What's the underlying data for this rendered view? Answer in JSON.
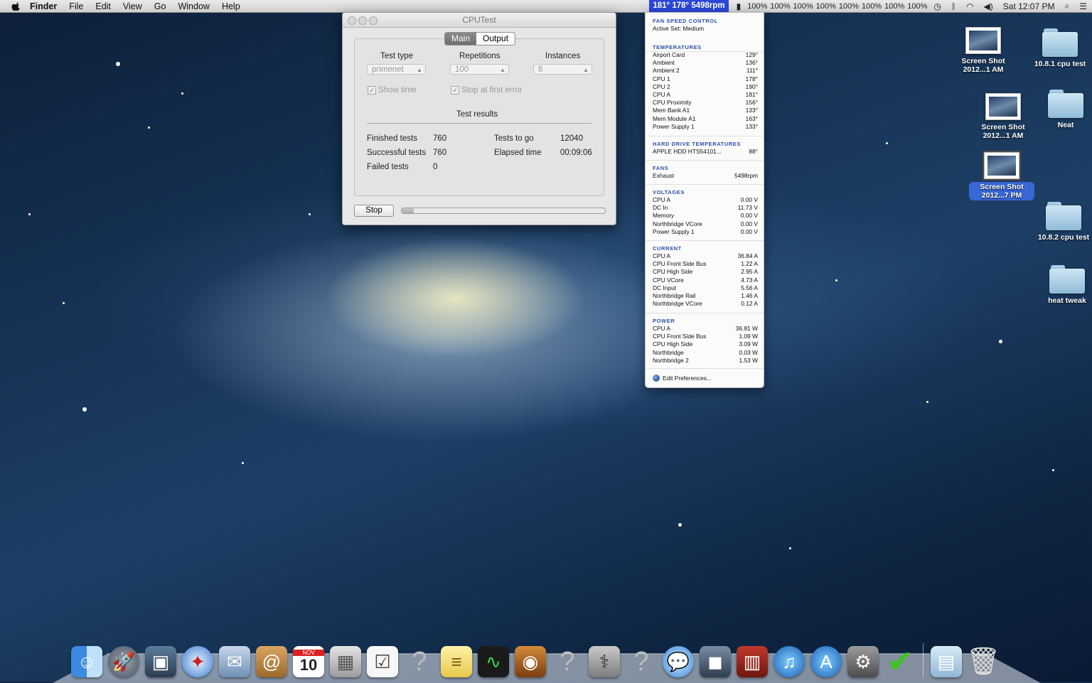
{
  "menubar": {
    "app": "Finder",
    "items": [
      "File",
      "Edit",
      "View",
      "Go",
      "Window",
      "Help"
    ],
    "temp_badge": "181° 178° 5498rpm",
    "cpu_usage": [
      "100%",
      "100%",
      "100%",
      "100%",
      "100%",
      "100%",
      "100%",
      "100%"
    ],
    "clock": "Sat 12:07 PM"
  },
  "window": {
    "title": "CPUTest",
    "tabs": [
      "Main",
      "Output"
    ],
    "active_tab": "Main",
    "labels": {
      "test_type": "Test type",
      "repetitions": "Repetitions",
      "instances": "Instances"
    },
    "values": {
      "test_type": "primenet",
      "repetitions": "100",
      "instances": "8"
    },
    "checkboxes": {
      "show_time": "Show time",
      "stop_first_error": "Stop at first error"
    },
    "results_title": "Test results",
    "results": {
      "finished_label": "Finished tests",
      "finished": "760",
      "successful_label": "Successful tests",
      "successful": "760",
      "failed_label": "Failed tests",
      "failed": "0",
      "togo_label": "Tests to go",
      "togo": "12040",
      "elapsed_label": "Elapsed time",
      "elapsed": "00:09:06"
    },
    "stop_button": "Stop",
    "progress": 0.06
  },
  "dropdown": {
    "fan_control": {
      "title": "FAN SPEED CONTROL",
      "active_label": "Active Set:",
      "active_value": "Medium"
    },
    "temperatures": {
      "title": "TEMPERATURES",
      "rows": [
        {
          "name": "Airport Card",
          "value": "129°"
        },
        {
          "name": "Ambient",
          "value": "136°"
        },
        {
          "name": "Ambient 2",
          "value": "111°"
        },
        {
          "name": "CPU 1",
          "value": "178°"
        },
        {
          "name": "CPU 2",
          "value": "190°"
        },
        {
          "name": "CPU A",
          "value": "181°"
        },
        {
          "name": "CPU Proximity",
          "value": "156°"
        },
        {
          "name": "Mem Bank A1",
          "value": "133°"
        },
        {
          "name": "Mem Module A1",
          "value": "163°"
        },
        {
          "name": "Power Supply 1",
          "value": "133°"
        }
      ]
    },
    "hdd": {
      "title": "HARD DRIVE TEMPERATURES",
      "rows": [
        {
          "name": "APPLE HDD HTS54101...",
          "value": "88°"
        }
      ]
    },
    "fans": {
      "title": "FANS",
      "rows": [
        {
          "name": "Exhaust",
          "value": "5498rpm"
        }
      ]
    },
    "voltages": {
      "title": "VOLTAGES",
      "rows": [
        {
          "name": "CPU A",
          "value": "0.00 V"
        },
        {
          "name": "DC In",
          "value": "11.73 V"
        },
        {
          "name": "Memory",
          "value": "0.00 V"
        },
        {
          "name": "Northbridge VCore",
          "value": "0.00 V"
        },
        {
          "name": "Power Supply 1",
          "value": "0.00 V"
        }
      ]
    },
    "current": {
      "title": "CURRENT",
      "rows": [
        {
          "name": "CPU A",
          "value": "36.84 A"
        },
        {
          "name": "CPU Front Side Bus",
          "value": "1.22 A"
        },
        {
          "name": "CPU High Side",
          "value": "2.95 A"
        },
        {
          "name": "CPU VCore",
          "value": "4.73 A"
        },
        {
          "name": "DC Input",
          "value": "5.56 A"
        },
        {
          "name": "Northbridge Rail",
          "value": "1.46 A"
        },
        {
          "name": "Northbridge VCore",
          "value": "0.12 A"
        }
      ]
    },
    "power": {
      "title": "POWER",
      "rows": [
        {
          "name": "CPU A",
          "value": "36.81 W"
        },
        {
          "name": "CPU Front Side Bus",
          "value": "1.09 W"
        },
        {
          "name": "CPU High Side",
          "value": "3.09 W"
        },
        {
          "name": "Northbridge",
          "value": "0.03 W"
        },
        {
          "name": "Northbridge 2",
          "value": "1.53 W"
        }
      ]
    },
    "edit_prefs": "Edit Preferences..."
  },
  "desktop": {
    "shot1": "Screen Shot 2012...1 AM",
    "shot2": "Screen Shot 2012...1 AM",
    "shot3": "Screen Shot 2012...7 PM",
    "folder1": "10.8.1 cpu test",
    "folder2": "Neat",
    "folder3": "10.8.2 cpu test",
    "folder4": "heat tweak"
  },
  "dock": {
    "calendar_month": "NOV",
    "calendar_day": "10",
    "apps": [
      "finder-icon",
      "launchpad-icon",
      "iphoto-icon",
      "safari-icon",
      "mail-icon",
      "contacts-icon",
      "calendar-icon",
      "calculator-icon",
      "reminders-icon",
      "unknown-app-icon",
      "notes-icon",
      "activity-monitor-icon",
      "iphoto-camera-icon",
      "unknown-app-icon",
      "disk-utility-icon",
      "unknown-app-icon",
      "messages-icon",
      "facetime-icon",
      "photo-booth-icon",
      "itunes-icon",
      "app-store-icon",
      "system-preferences-icon",
      "checkmark-app-icon"
    ]
  }
}
